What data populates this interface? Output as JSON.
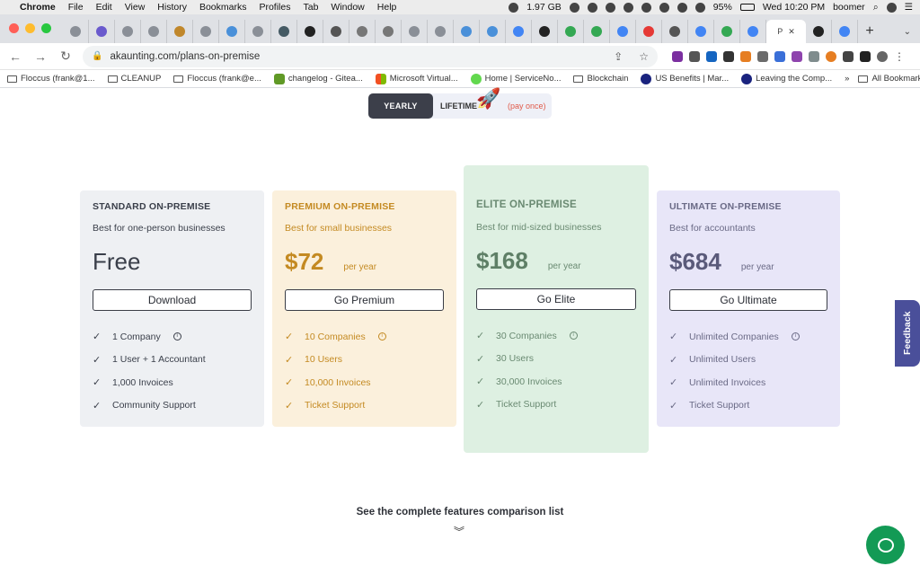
{
  "menubar": {
    "app": "Chrome",
    "items": [
      "File",
      "Edit",
      "View",
      "History",
      "Bookmarks",
      "Profiles",
      "Tab",
      "Window",
      "Help"
    ],
    "memory": "1.97 GB",
    "battery": "95%",
    "clock": "Wed 10:20 PM",
    "user": "boomer"
  },
  "tabs": {
    "count_inactive": 27,
    "active_label": "P"
  },
  "toolbar": {
    "url": "akaunting.com/plans-on-premise"
  },
  "bookmarks": {
    "items": [
      "Floccus (frank@1...",
      "CLEANUP",
      "Floccus (frank@e...",
      "changelog - Gitea...",
      "Microsoft Virtual...",
      "Home | ServiceNo...",
      "Blockchain",
      "US Benefits | Mar...",
      "Leaving the Comp..."
    ],
    "overflow": "»",
    "all_bookmarks": "All Bookmarks"
  },
  "billing": {
    "yearly": "YEARLY",
    "lifetime": "LIFETIME",
    "pay_once": "(pay once)"
  },
  "plans": {
    "standard": {
      "name": "STANDARD ON-PREMISE",
      "desc": "Best for one-person businesses",
      "price": "Free",
      "per": "",
      "cta": "Download",
      "features": [
        "1 Company",
        "1 User + 1 Accountant",
        "1,000 Invoices",
        "Community Support"
      ]
    },
    "premium": {
      "name": "PREMIUM ON-PREMISE",
      "desc": "Best for small businesses",
      "price": "$72",
      "per": "per year",
      "cta": "Go Premium",
      "features": [
        "10 Companies",
        "10 Users",
        "10,000 Invoices",
        "Ticket Support"
      ]
    },
    "elite": {
      "name": "ELITE ON-PREMISE",
      "desc": "Best for mid-sized businesses",
      "price": "$168",
      "per": "per year",
      "cta": "Go Elite",
      "features": [
        "30 Companies",
        "30 Users",
        "30,000 Invoices",
        "Ticket Support"
      ]
    },
    "ultimate": {
      "name": "ULTIMATE ON-PREMISE",
      "desc": "Best for accountants",
      "price": "$684",
      "per": "per year",
      "cta": "Go Ultimate",
      "features": [
        "Unlimited Companies",
        "Unlimited Users",
        "Unlimited Invoices",
        "Ticket Support"
      ]
    }
  },
  "compare_link": "See the complete features comparison list",
  "feedback": "Feedback",
  "colors": {
    "standard_bg": "#eef0f3",
    "premium_bg": "#fbf0dc",
    "elite_bg": "#def0e2",
    "ultimate_bg": "#e8e6f8",
    "chat_green": "#139a55",
    "feedback_purple": "#4a4f9a"
  }
}
